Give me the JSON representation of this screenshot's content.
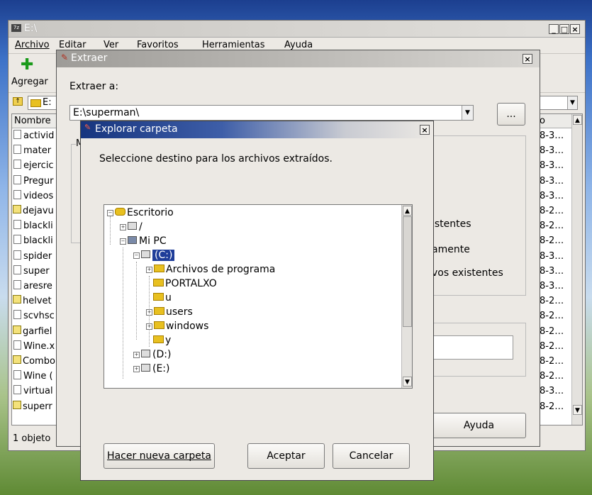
{
  "main_window": {
    "title": "E:\\",
    "menu": [
      "Archivo",
      "Editar",
      "Ver",
      "Favoritos",
      "Herramientas",
      "Ayuda"
    ],
    "toolbar_add_label": "Agregar",
    "address_value": "E:",
    "column_name": "Nombre",
    "column_date": "o",
    "files": [
      {
        "name": "activid",
        "date": "8-3…",
        "icon": "file-icon"
      },
      {
        "name": "mater",
        "date": "8-3…",
        "icon": "file-icon"
      },
      {
        "name": "ejercic",
        "date": "8-3…",
        "icon": "file-icon"
      },
      {
        "name": "Pregur",
        "date": "8-3…",
        "icon": "file-icon"
      },
      {
        "name": "videos",
        "date": "8-3…",
        "icon": "file-icon"
      },
      {
        "name": "dejavu",
        "date": "8-2…",
        "icon": "shortcut-icon"
      },
      {
        "name": "blackli",
        "date": "8-2…",
        "icon": "file-icon"
      },
      {
        "name": "blackli",
        "date": "8-2…",
        "icon": "file-icon"
      },
      {
        "name": "spider",
        "date": "8-3…",
        "icon": "file-icon"
      },
      {
        "name": "super",
        "date": "8-3…",
        "icon": "file-icon"
      },
      {
        "name": "aresre",
        "date": "8-3…",
        "icon": "file-icon"
      },
      {
        "name": "helvet",
        "date": "8-2…",
        "icon": "shortcut-icon"
      },
      {
        "name": "scvhsc",
        "date": "8-2…",
        "icon": "file-icon"
      },
      {
        "name": "garfiel",
        "date": "8-2…",
        "icon": "shortcut-icon"
      },
      {
        "name": "Wine.x",
        "date": "8-2…",
        "icon": "file-icon"
      },
      {
        "name": "Combo",
        "date": "8-2…",
        "icon": "shortcut-icon"
      },
      {
        "name": "Wine (",
        "date": "8-2…",
        "icon": "file-icon"
      },
      {
        "name": "virtual",
        "date": "8-3…",
        "icon": "file-icon"
      },
      {
        "name": "superr",
        "date": "8-2…",
        "icon": "shortcut-icon"
      }
    ],
    "status": "1 objeto"
  },
  "extract_dialog": {
    "title": "Extraer",
    "extract_to_label": "Extraer a:",
    "path_value": "E:\\superman\\",
    "browse_label": "...",
    "group_letter": "M",
    "option_1": "istentes",
    "option_2": "amente",
    "option_3": "vos existentes",
    "help_label": "Ayuda"
  },
  "browse_dialog": {
    "title": "Explorar carpeta",
    "prompt": "Seleccione destino para los archivos extraídos.",
    "tree": {
      "desktop": "Escritorio",
      "root": "/",
      "my_pc": "Mi PC",
      "c_drive": "(C:)",
      "program_files": "Archivos de programa",
      "portalxo": "PORTALXO",
      "u": "u",
      "users": "users",
      "windows": "windows",
      "y": "y",
      "d_drive": "(D:)",
      "e_drive": "(E:)"
    },
    "new_folder_label": "Hacer nueva carpeta",
    "accept_label": "Aceptar",
    "cancel_label": "Cancelar"
  },
  "colors": {
    "title_gradient_start": "#1a3a8a",
    "title_gradient_end": "#ece9e4",
    "selection": "#1f3d99"
  }
}
